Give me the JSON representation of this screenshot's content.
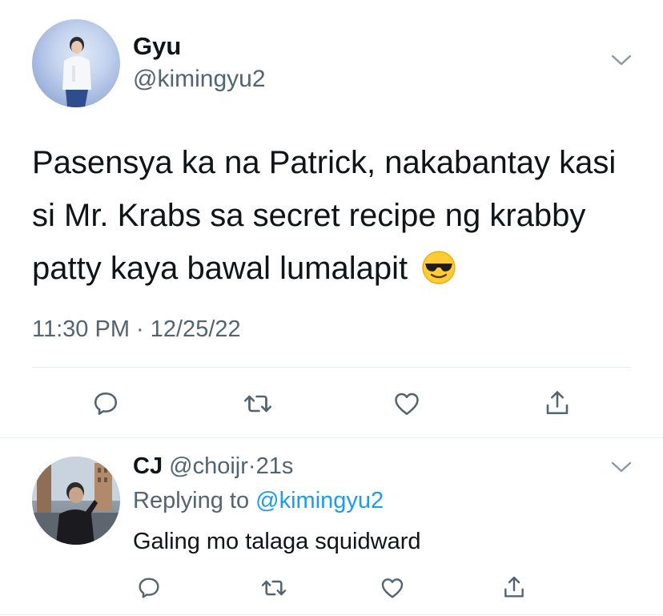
{
  "tweet": {
    "author_name": "Gyu",
    "author_handle": "@kimingyu2",
    "text": "Pasensya ka na Patrick, nakabantay kasi si Mr. Krabs sa secret recipe ng krabby patty kaya bawal lumalapit",
    "emoji": "smiling-face-with-sunglasses",
    "timestamp": "11:30 PM · 12/25/22",
    "actions": [
      "reply-icon",
      "retweet-icon",
      "like-icon",
      "share-icon"
    ]
  },
  "reply": {
    "author_name": "CJ",
    "author_handle": "@choijr",
    "separator": "·",
    "time": "21s",
    "replying_prefix": "Replying to",
    "replying_mention": "@kimingyu2",
    "text": "Galing mo talaga squidward",
    "actions": [
      "reply-icon",
      "retweet-icon",
      "like-icon",
      "share-icon"
    ]
  },
  "colors": {
    "primary_text": "#0f1419",
    "secondary_text": "#536471",
    "link": "#1d9bf0",
    "divider": "#e6ecf0",
    "icon": "#536471"
  }
}
